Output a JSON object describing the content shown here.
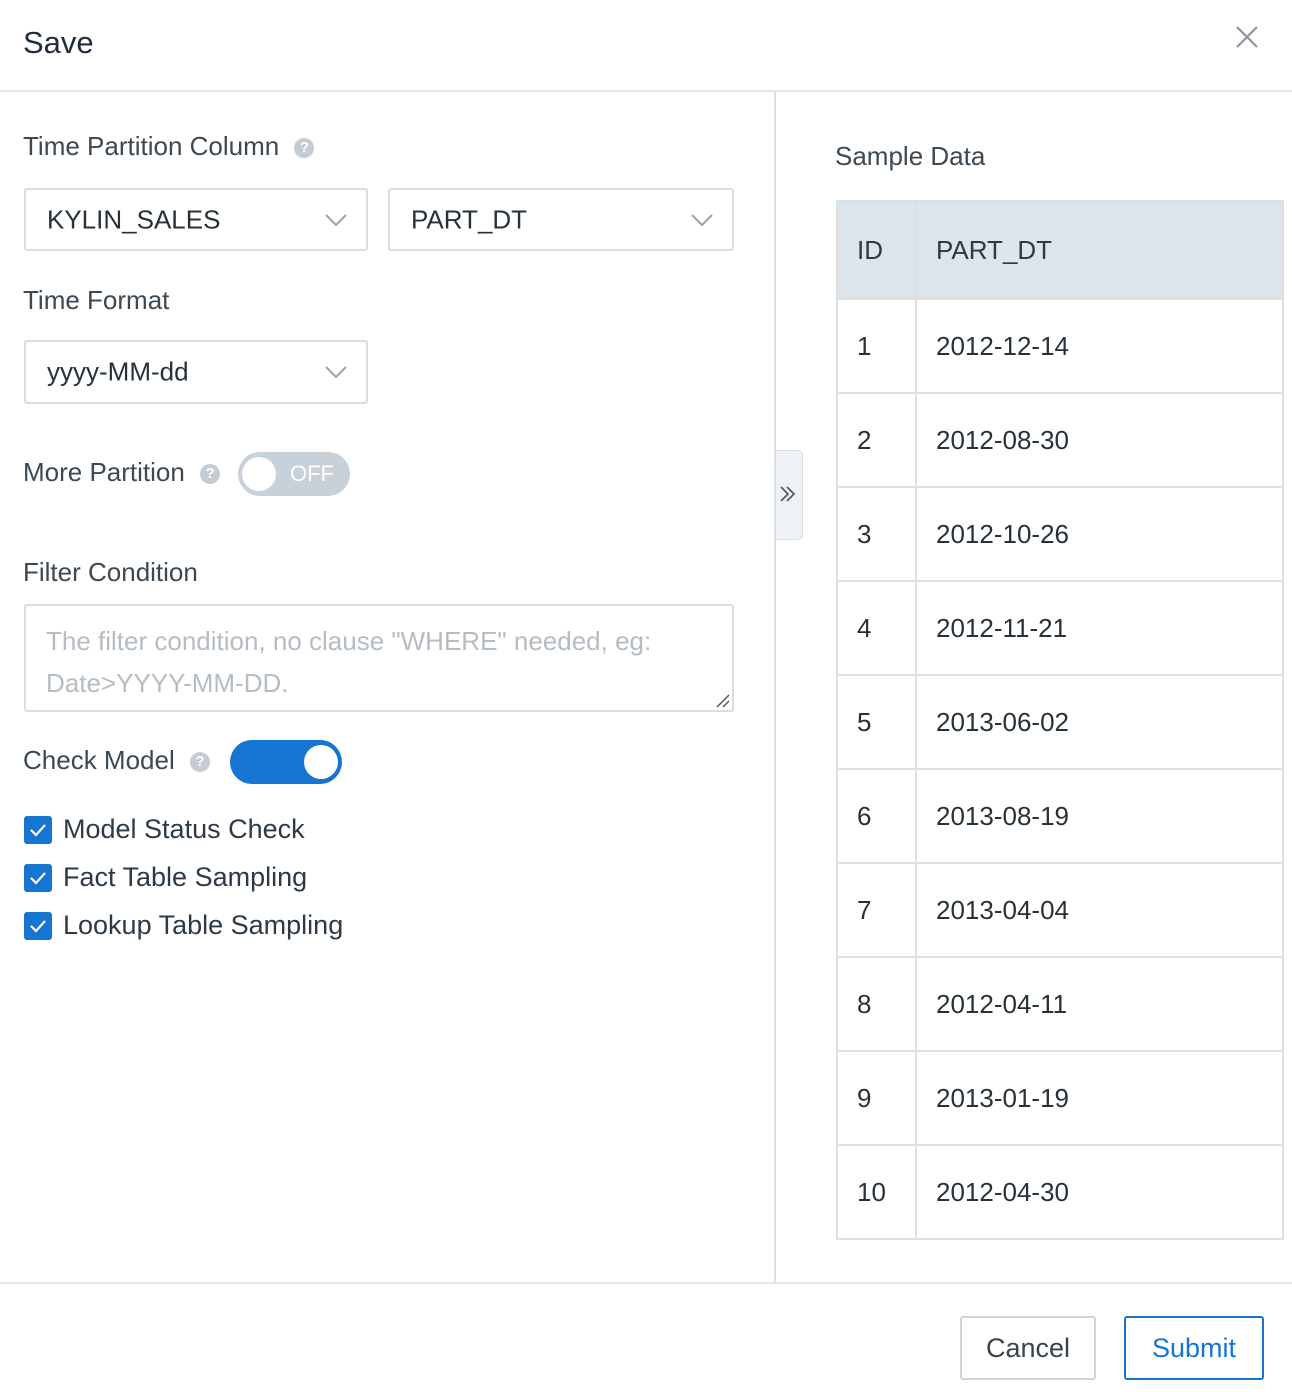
{
  "dialog": {
    "title": "Save",
    "close_icon": "close-icon"
  },
  "form": {
    "time_partition": {
      "label": "Time Partition Column",
      "help_icon": "question-icon",
      "table_value": "KYLIN_SALES",
      "column_value": "PART_DT"
    },
    "time_format": {
      "label": "Time Format",
      "value": "yyyy-MM-dd"
    },
    "more_partition": {
      "label": "More Partition",
      "state": "OFF",
      "help_icon": "question-icon"
    },
    "filter_condition": {
      "label": "Filter Condition",
      "placeholder": "The filter condition, no clause \"WHERE\" needed, eg: Date>YYYY-MM-DD."
    },
    "check_model": {
      "label": "Check Model",
      "enabled": true,
      "help_icon": "question-icon",
      "options": [
        {
          "label": "Model Status Check",
          "checked": true
        },
        {
          "label": "Fact Table Sampling",
          "checked": true
        },
        {
          "label": "Lookup Table Sampling",
          "checked": true
        }
      ]
    }
  },
  "sample": {
    "title": "Sample Data",
    "headers": [
      "ID",
      "PART_DT"
    ],
    "rows": [
      [
        "1",
        "2012-12-14"
      ],
      [
        "2",
        "2012-08-30"
      ],
      [
        "3",
        "2012-10-26"
      ],
      [
        "4",
        "2012-11-21"
      ],
      [
        "5",
        "2013-06-02"
      ],
      [
        "6",
        "2013-08-19"
      ],
      [
        "7",
        "2013-04-04"
      ],
      [
        "8",
        "2012-04-11"
      ],
      [
        "9",
        "2013-01-19"
      ],
      [
        "10",
        "2012-04-30"
      ]
    ]
  },
  "footer": {
    "cancel_label": "Cancel",
    "submit_label": "Submit"
  },
  "colors": {
    "accent": "#1775d2",
    "switch_off": "#c8d0d8",
    "table_header_bg": "#dce5ec"
  }
}
